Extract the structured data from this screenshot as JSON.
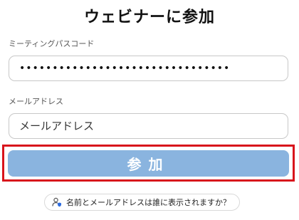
{
  "page": {
    "title": "ウェビナーに参加"
  },
  "form": {
    "passcode_label": "ミーティングパスコード",
    "passcode_value": "••••••••••••••••••••••••••••••••",
    "email_label": "メールアドレス",
    "email_placeholder": "メールアドレス",
    "join_button_label": "参加"
  },
  "help": {
    "text": "名前とメールアドレスは誰に表示されますか？",
    "icon": "user-shield-icon"
  },
  "colors": {
    "button_bg": "#8ab4df",
    "highlight_border": "#d8141c"
  }
}
